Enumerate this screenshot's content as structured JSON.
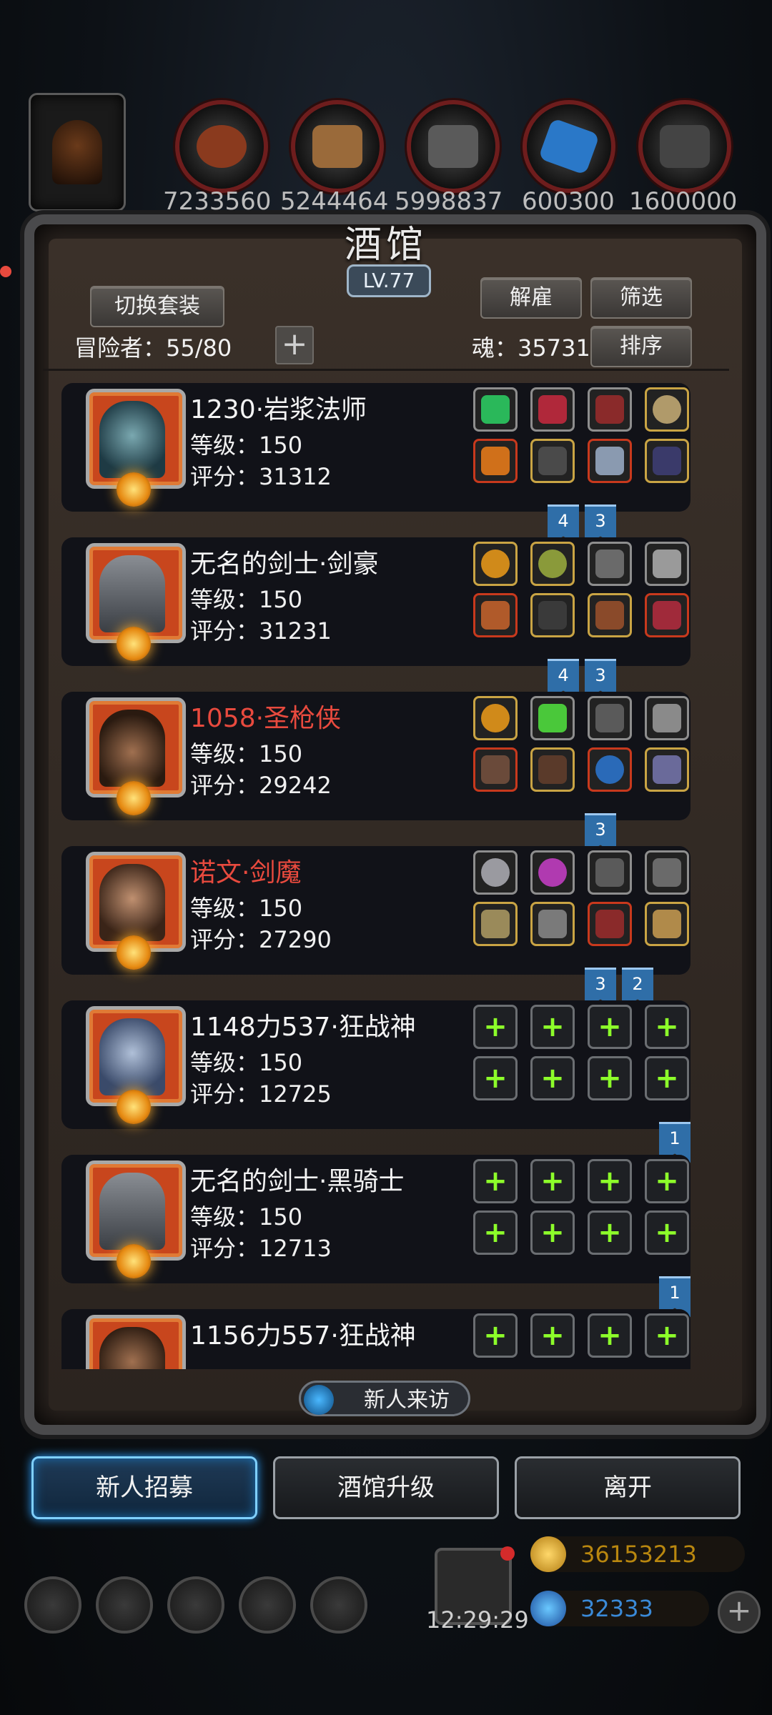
{
  "resources": [
    "7233560",
    "5244464",
    "5998837",
    "600300",
    "1600000"
  ],
  "title": "酒馆",
  "level": "LV.77",
  "buttons": {
    "switch_set": "切换套装",
    "dismiss": "解雇",
    "filter": "筛选",
    "sort": "排序",
    "new_visitor": "新人来访",
    "recruit": "新人招募",
    "upgrade": "酒馆升级",
    "leave": "离开"
  },
  "adventurers_label": "冒险者：55/80",
  "soul_label": "魂：35731",
  "heroes": [
    {
      "name": "1230·岩浆法师",
      "level": "等级：150",
      "score": "评分：31312",
      "name_color": "#f4f4f4",
      "face": "#2a5a66",
      "flags": [
        "4",
        "3"
      ]
    },
    {
      "name": "无名的剑士·剑豪",
      "level": "等级：150",
      "score": "评分：31231",
      "name_color": "#f4f4f4",
      "face": "#4a4e54",
      "flags": [
        "4",
        "3"
      ]
    },
    {
      "name": "1058·圣枪侠",
      "level": "等级：150",
      "score": "评分：29242",
      "name_color": "#e84a3e",
      "face": "#5a3a22",
      "flags": [
        "3"
      ]
    },
    {
      "name": "诺文·剑魔",
      "level": "等级：150",
      "score": "评分：27290",
      "name_color": "#e84a3e",
      "face": "#6a4a30",
      "flags": [
        "3",
        "2"
      ]
    },
    {
      "name": "1148力537·狂战神",
      "level": "等级：150",
      "score": "评分：12725",
      "name_color": "#f4f4f4",
      "face": "#6a7e9a",
      "flags": [
        "1"
      ]
    },
    {
      "name": "无名的剑士·黑骑士",
      "level": "等级：150",
      "score": "评分：12713",
      "name_color": "#f4f4f4",
      "face": "#4a4e54",
      "flags": [
        "1"
      ]
    },
    {
      "name": "1156力557·狂战神",
      "level": "",
      "score": "",
      "name_color": "#f4f4f4",
      "face": "#5a3a22",
      "flags": []
    }
  ],
  "currency": {
    "gold": "36153213",
    "gem": "32333"
  },
  "clock": "12:29:29",
  "colors": {
    "accent_glow": "#2aa0ff",
    "plus_green": "#8dff2a",
    "name_red": "#e84a3e"
  }
}
